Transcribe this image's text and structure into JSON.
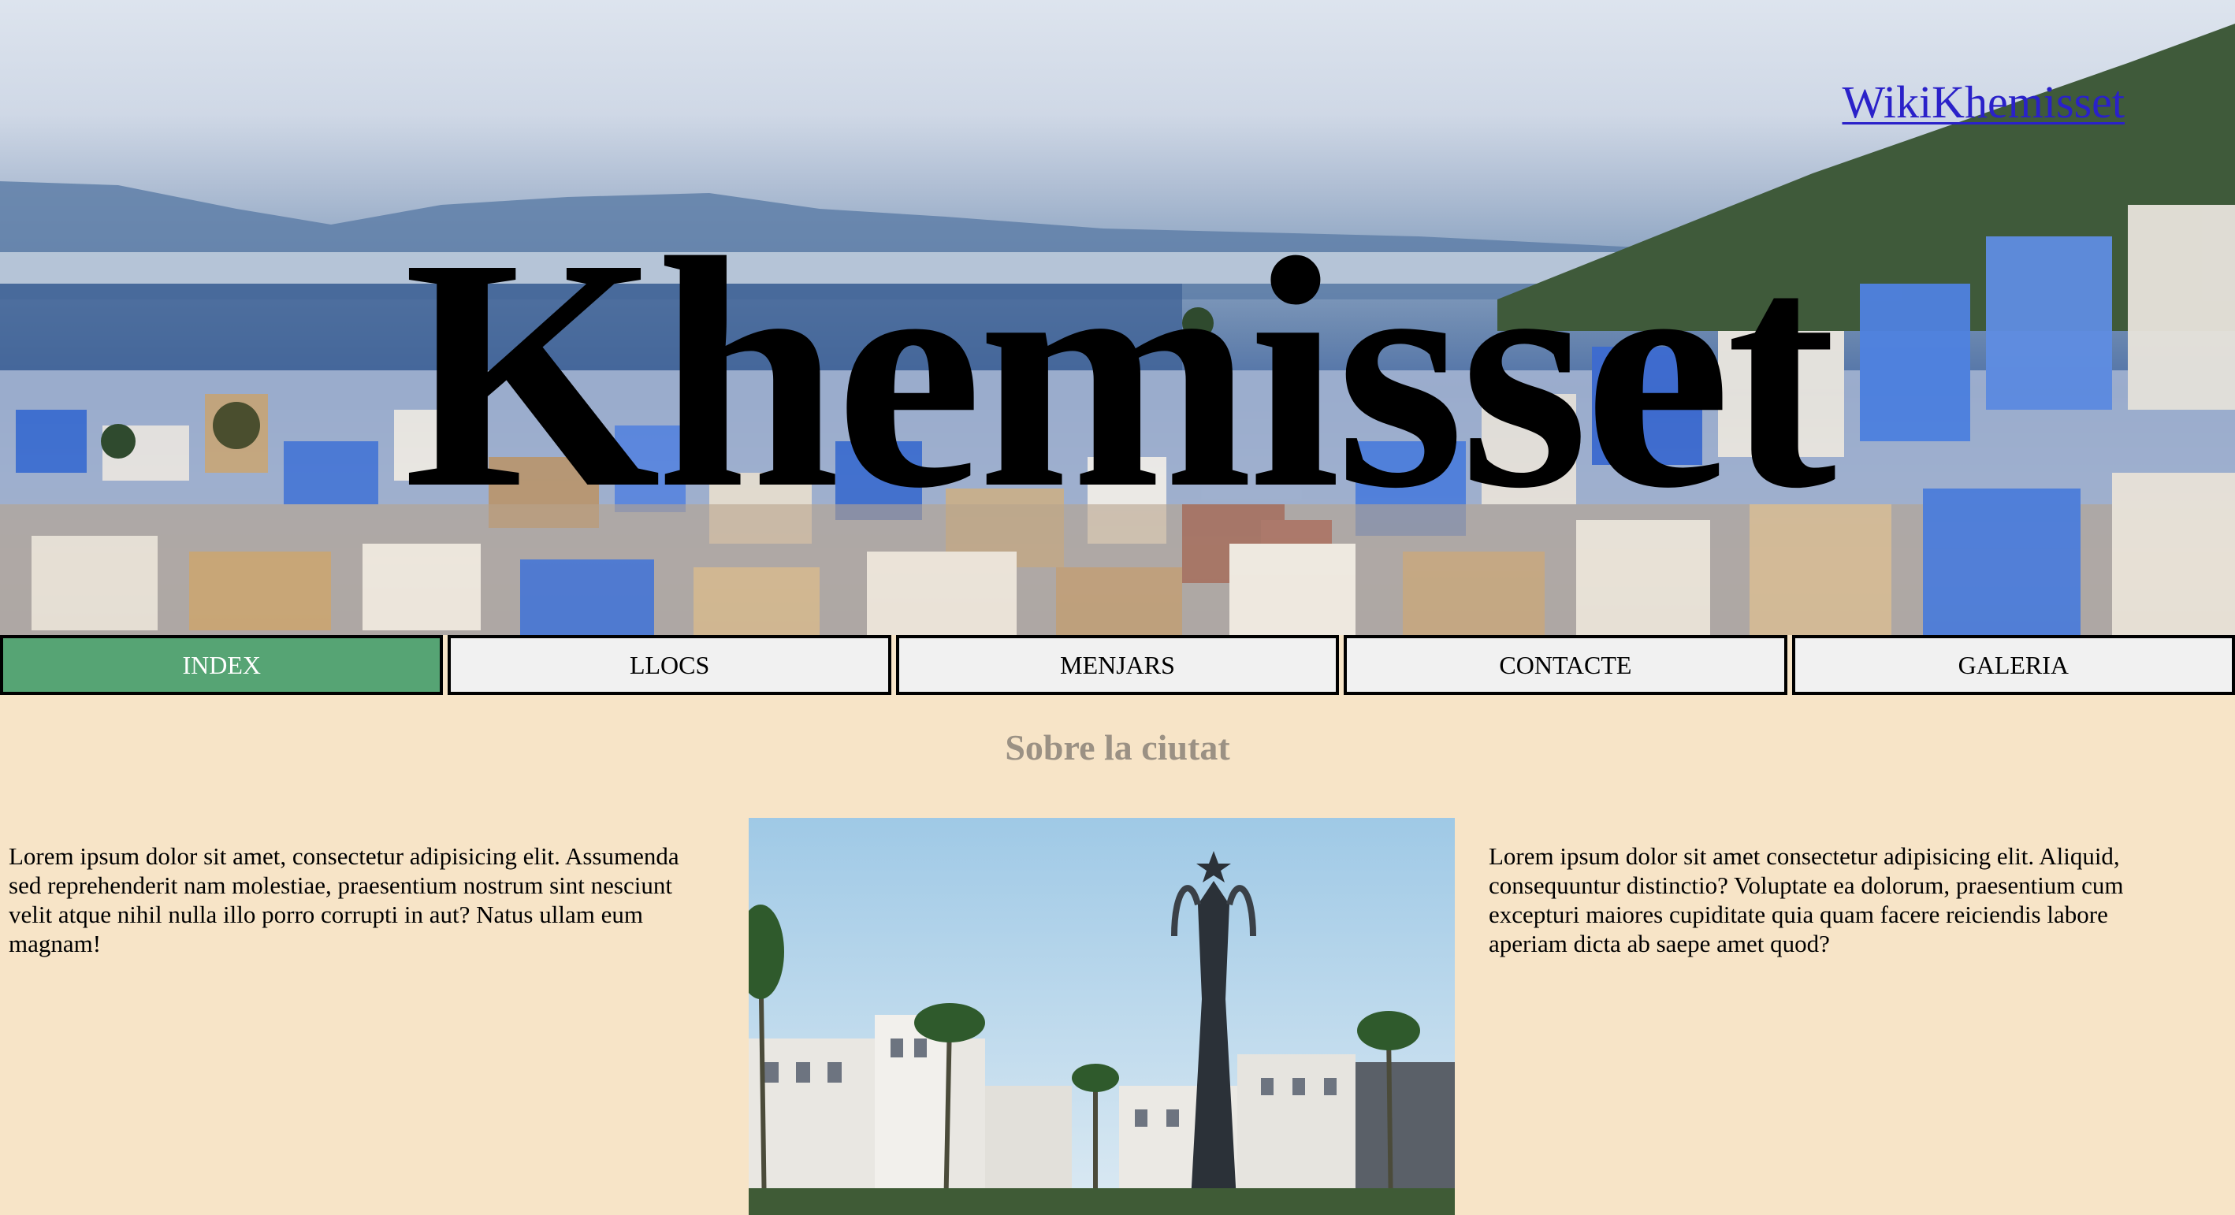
{
  "header": {
    "site_link": "WikiKhemisset",
    "title": "Khemisset",
    "background_image": "city-panorama-blue-houses-mountains"
  },
  "nav": {
    "items": [
      {
        "label": "INDEX",
        "active": true
      },
      {
        "label": "LLOCS",
        "active": false
      },
      {
        "label": "MENJARS",
        "active": false
      },
      {
        "label": "CONTACTE",
        "active": false
      },
      {
        "label": "GALERIA",
        "active": false
      }
    ],
    "active_color": "#56a474"
  },
  "main": {
    "section_title": "Sobre la ciutat",
    "left_text": "Lorem ipsum dolor sit amet, consectetur adipisicing elit. Assumenda sed reprehenderit nam molestiae, praesentium nostrum sint nesciunt velit atque nihil nulla illo porro corrupti in aut? Natus ullam eum magnam!",
    "right_text": "Lorem ipsum dolor sit amet consectetur adipisicing elit. Aliquid, consequuntur distinctio? Voluptate ea dolorum, praesentium cum excepturi maiores cupiditate quia quam facere reiciendis labore aperiam dicta ab saepe amet quod?",
    "image": "city-monument-crown-palms"
  },
  "colors": {
    "page_background": "#f7e4c7",
    "link": "#2a21c9",
    "section_title": "#9b9184"
  }
}
